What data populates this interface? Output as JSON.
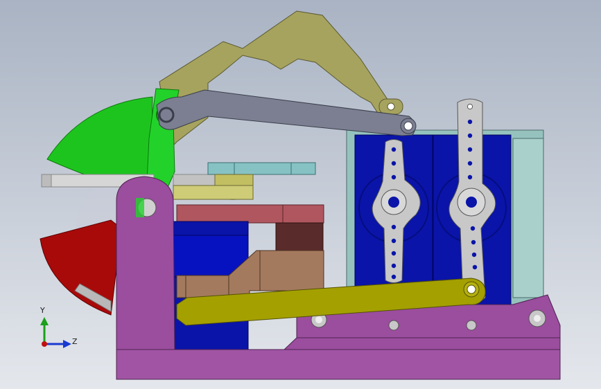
{
  "triad": {
    "y_label": "Y",
    "z_label": "Z",
    "colors": {
      "y": "#1aa01a",
      "z": "#1a3ad0",
      "origin": "#c01010"
    }
  },
  "colors": {
    "background_top": "#a9b3c3",
    "background_bottom": "#e4e7ec",
    "olive_bracket": "#a6a35e",
    "gray_link": "#7b7f91",
    "green_scoop": "#1ec41e",
    "red_scoop": "#a80a0a",
    "magenta_frame": "#9b4d9e",
    "blue_servo": "#0a14a8",
    "teal_plate": "#96c2be",
    "yellow_link": "#a4a000",
    "brown_block": "#a47a5e",
    "rose_bar": "#b0565f"
  }
}
